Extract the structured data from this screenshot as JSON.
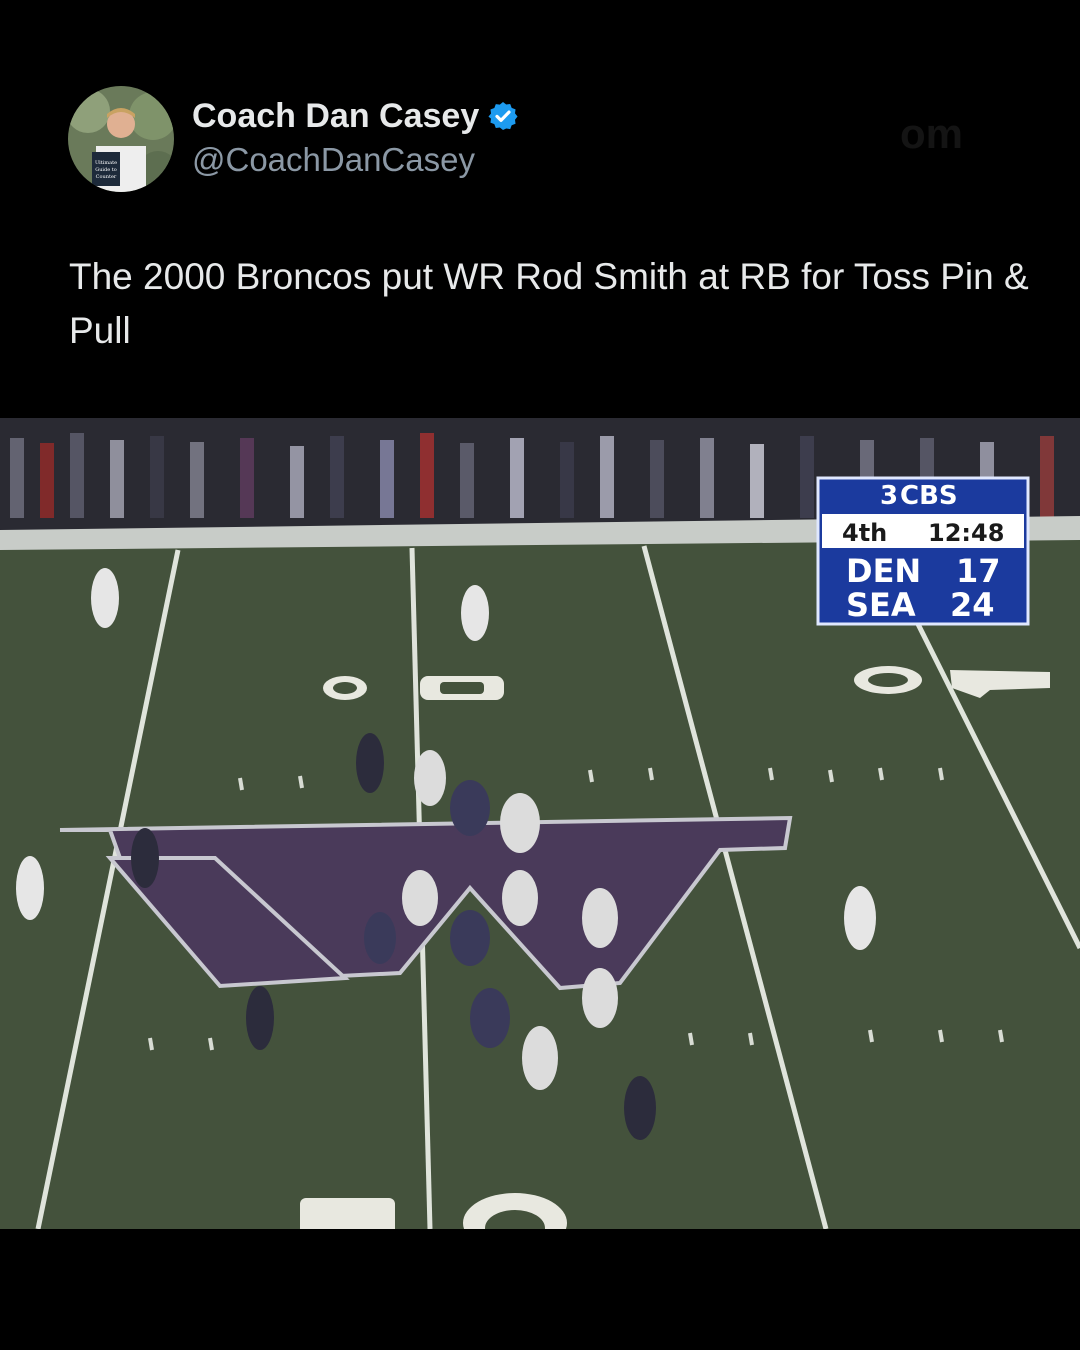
{
  "author": {
    "display_name": "Coach Dan Casey",
    "handle": "@CoachDanCasey",
    "verified": true,
    "avatar_book_text": "Ultimate Guide to Counter"
  },
  "watermark": "om",
  "tweet": {
    "text": "The 2000 Broncos put WR Rod Smith at RB for Toss Pin & Pull"
  },
  "video": {
    "scorebug": {
      "network": "CBS",
      "network_mark": "3",
      "quarter": "4th",
      "clock": "12:48",
      "team1": "DEN",
      "score1": "17",
      "team2": "SEA",
      "score2": "24"
    },
    "field_numbers": {
      "top_left": "0 5",
      "top_right": "0 4-",
      "bottom": "5 0"
    }
  },
  "colors": {
    "background": "#000000",
    "text": "#e7e9ea",
    "handle": "#8b98a5",
    "verified": "#1d9bf0",
    "field": "#44523c",
    "logo": "#4a3a5a",
    "scorebug": "#1b3a9e"
  }
}
